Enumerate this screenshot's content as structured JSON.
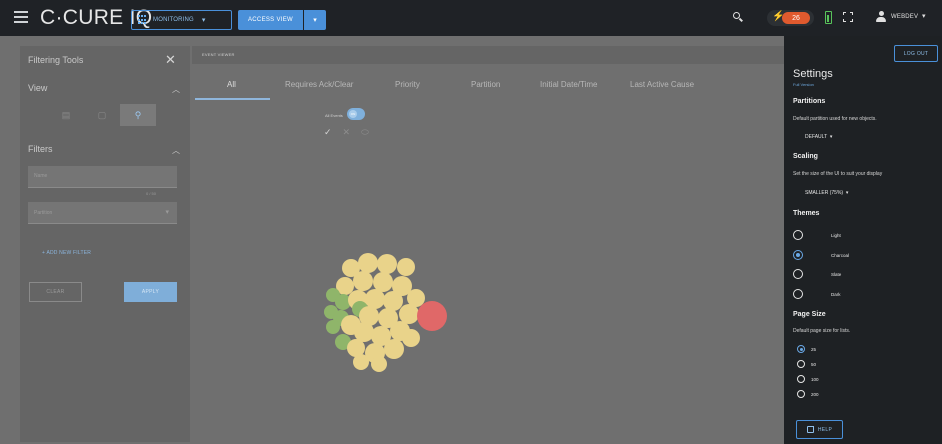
{
  "topbar": {
    "brand": "C·CURE IQ",
    "monitoring_label": "MONITORING",
    "access_view_label": "ACCESS VIEW",
    "alarm_count": "26",
    "user_name": "WEBDEV"
  },
  "filter_panel": {
    "title": "Filtering Tools",
    "view_label": "View",
    "filters_label": "Filters",
    "name_placeholder": "Name",
    "name_counter": "0 / 50",
    "partition_placeholder": "Partition",
    "add_filter_label": "ADD NEW FILTER",
    "clear_label": "CLEAR",
    "apply_label": "APPLY"
  },
  "event_viewer": {
    "title": "EVENT VIEWER",
    "tabs": [
      "All",
      "Requires Ack/Clear",
      "Priority",
      "Partition",
      "Initial Date/Time",
      "Last Active Cause"
    ],
    "all_events_label": "All Events",
    "all_events_toggle": "ON"
  },
  "colors": {
    "accent": "#4a90d9",
    "alarm": "#e05a2e",
    "bubble_yellow": "#e9d38a",
    "bubble_green": "#8fb56a",
    "bubble_red": "#e06868"
  },
  "settings": {
    "logout_label": "LOG OUT",
    "title": "Settings",
    "sub_link": "Full Version",
    "partitions_label": "Partitions",
    "partitions_desc": "Default partition used for new objects.",
    "partition_value": "DEFAULT",
    "scaling_label": "Scaling",
    "scaling_desc": "Set the size of the UI to suit your display",
    "scaling_value": "SMALLER (75%)",
    "themes_label": "Themes",
    "themes": [
      {
        "label": "Light",
        "selected": false
      },
      {
        "label": "Charcoal",
        "selected": true
      },
      {
        "label": "Slate",
        "selected": false
      },
      {
        "label": "Dark",
        "selected": false
      }
    ],
    "page_size_label": "Page Size",
    "page_size_desc": "Default page size for lists.",
    "page_sizes": [
      {
        "label": "25",
        "selected": true
      },
      {
        "label": "50",
        "selected": false
      },
      {
        "label": "100",
        "selected": false
      },
      {
        "label": "200",
        "selected": false
      }
    ],
    "help_label": "HELP"
  }
}
